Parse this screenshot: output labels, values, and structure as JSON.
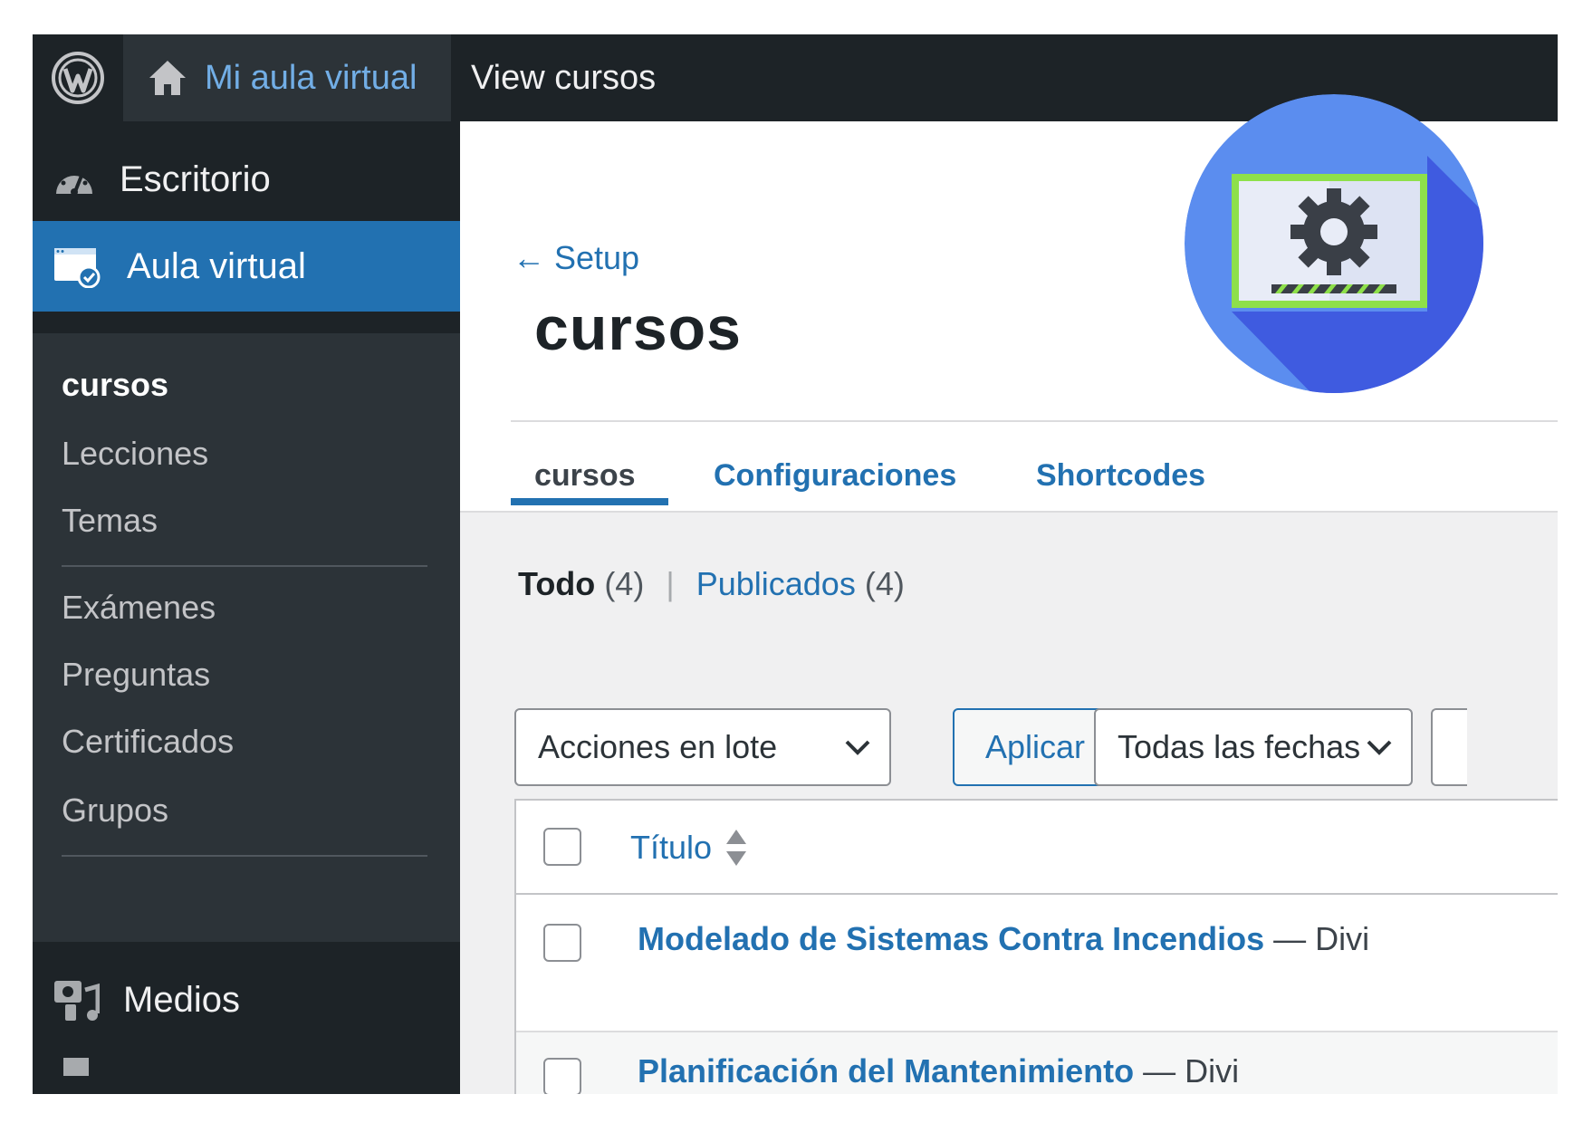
{
  "adminbar": {
    "site_name": "Mi aula virtual",
    "view_link": "View cursos"
  },
  "sidebar": {
    "dashboard": "Escritorio",
    "current_menu": "Aula virtual",
    "submenu": [
      "cursos",
      "Lecciones",
      "Temas",
      "Exámenes",
      "Preguntas",
      "Certificados",
      "Grupos"
    ],
    "media": "Medios"
  },
  "header": {
    "back_link": "← Setup",
    "title": "cursos",
    "tabs": [
      "cursos",
      "Configuraciones",
      "Shortcodes"
    ]
  },
  "filters": {
    "all_label": "Todo",
    "all_count": "(4)",
    "separator": "|",
    "published_label": "Publicados",
    "published_count": "(4)"
  },
  "toolbar": {
    "bulk_actions": "Acciones en lote",
    "apply": "Aplicar",
    "dates": "Todas las fechas"
  },
  "table": {
    "column_title": "Título",
    "rows": [
      {
        "title": "Modelado de Sistemas Contra Incendios",
        "suffix": "— Divi"
      },
      {
        "title": "Planificación del Mantenimiento",
        "suffix": "— Divi"
      }
    ]
  },
  "colors": {
    "accent": "#2271b1",
    "adminbar_bg": "#1d2327",
    "badge_circle": "#5b8def",
    "badge_frame": "#8ee04a"
  }
}
